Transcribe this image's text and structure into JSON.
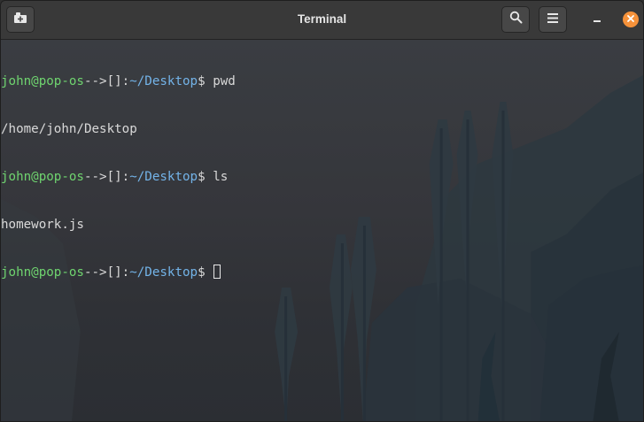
{
  "window": {
    "title": "Terminal",
    "icons": {
      "new_tab": "new-tab-icon",
      "search": "search-icon",
      "menu": "hamburger-menu-icon",
      "minimize": "minimize-icon",
      "close": "close-icon"
    },
    "colors": {
      "close_button": "#f6923a",
      "prompt_user": "#6fd46f",
      "prompt_path": "#73b3e8",
      "text": "#d9d9d9"
    }
  },
  "terminal": {
    "lines": [
      {
        "type": "prompt",
        "user": "john@pop-os",
        "sep": "-->[]:",
        "path": "~/Desktop",
        "sym": "$ ",
        "cmd": "pwd"
      },
      {
        "type": "output",
        "text": "/home/john/Desktop"
      },
      {
        "type": "prompt",
        "user": "john@pop-os",
        "sep": "-->[]:",
        "path": "~/Desktop",
        "sym": "$ ",
        "cmd": "ls"
      },
      {
        "type": "output",
        "text": "homework.js"
      },
      {
        "type": "prompt",
        "user": "john@pop-os",
        "sep": "-->[]:",
        "path": "~/Desktop",
        "sym": "$ ",
        "cmd": ""
      }
    ]
  }
}
